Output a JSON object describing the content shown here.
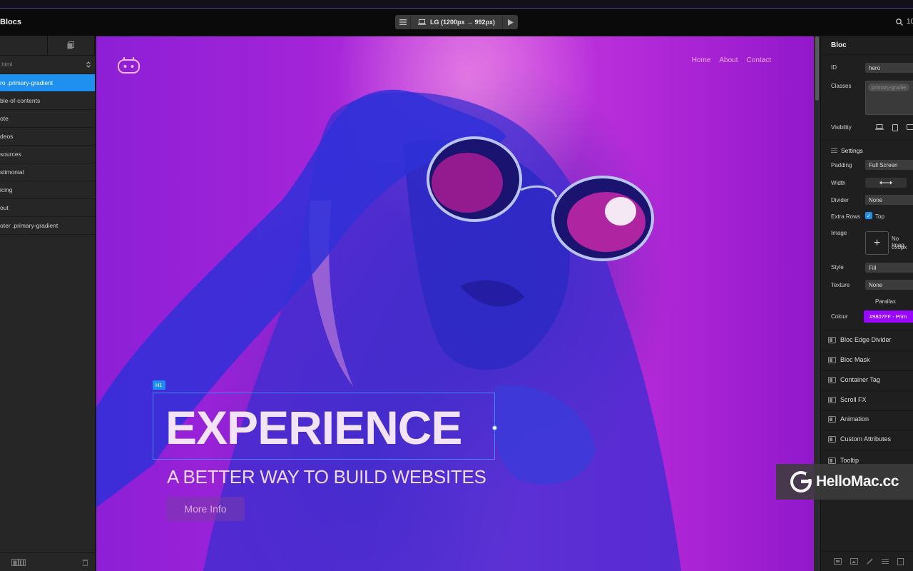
{
  "app": {
    "title": "Blocs"
  },
  "toolbar": {
    "device_label": "LG (1200px → 992px)",
    "zoom_text": "10"
  },
  "left_panel": {
    "page_select": ".html",
    "blocs": [
      {
        "label": "ro .primary-gradient",
        "selected": true
      },
      {
        "label": "ble-of-contents",
        "selected": false
      },
      {
        "label": "ote",
        "selected": false
      },
      {
        "label": "deos",
        "selected": false
      },
      {
        "label": "sources",
        "selected": false
      },
      {
        "label": "stimonial",
        "selected": false
      },
      {
        "label": "icing",
        "selected": false
      },
      {
        "label": "out",
        "selected": false
      },
      {
        "label": "oter .primary-gradient",
        "selected": false
      }
    ]
  },
  "canvas": {
    "nav": [
      "Home",
      "About",
      "Contact"
    ],
    "h1_tag": "H1",
    "headline": "EXPERIENCE",
    "subheadline": "A BETTER WAY TO BUILD WEBSITES",
    "button_label": "More Info"
  },
  "right_panel": {
    "title": "Bloc",
    "id_label": "ID",
    "id_value": "hero",
    "classes_label": "Classes",
    "class_chip": "primary-gradie",
    "visibility_label": "Visibility",
    "settings_label": "Settings",
    "padding_label": "Padding",
    "padding_value": "Full Screen",
    "width_label": "Width",
    "divider_label": "Divider",
    "divider_value": "None",
    "extra_rows_label": "Extra Rows",
    "extra_rows_value": "Top",
    "image_label": "Image",
    "image_name": "No Imag",
    "image_size": "0x0px",
    "style_label": "Style",
    "style_value": "Fill",
    "texture_label": "Texture",
    "texture_value": "None",
    "parallax_label": "Parallax",
    "colour_label": "Colour",
    "colour_value": "#9807FF - Prim",
    "colour_hex": "#9807ff",
    "features": [
      "Bloc Edge Divider",
      "Bloc Mask",
      "Container Tag",
      "Scroll FX",
      "Animation",
      "Custom Attributes",
      "Tooltip"
    ]
  },
  "watermark": {
    "text": "HelloMac.cc"
  }
}
